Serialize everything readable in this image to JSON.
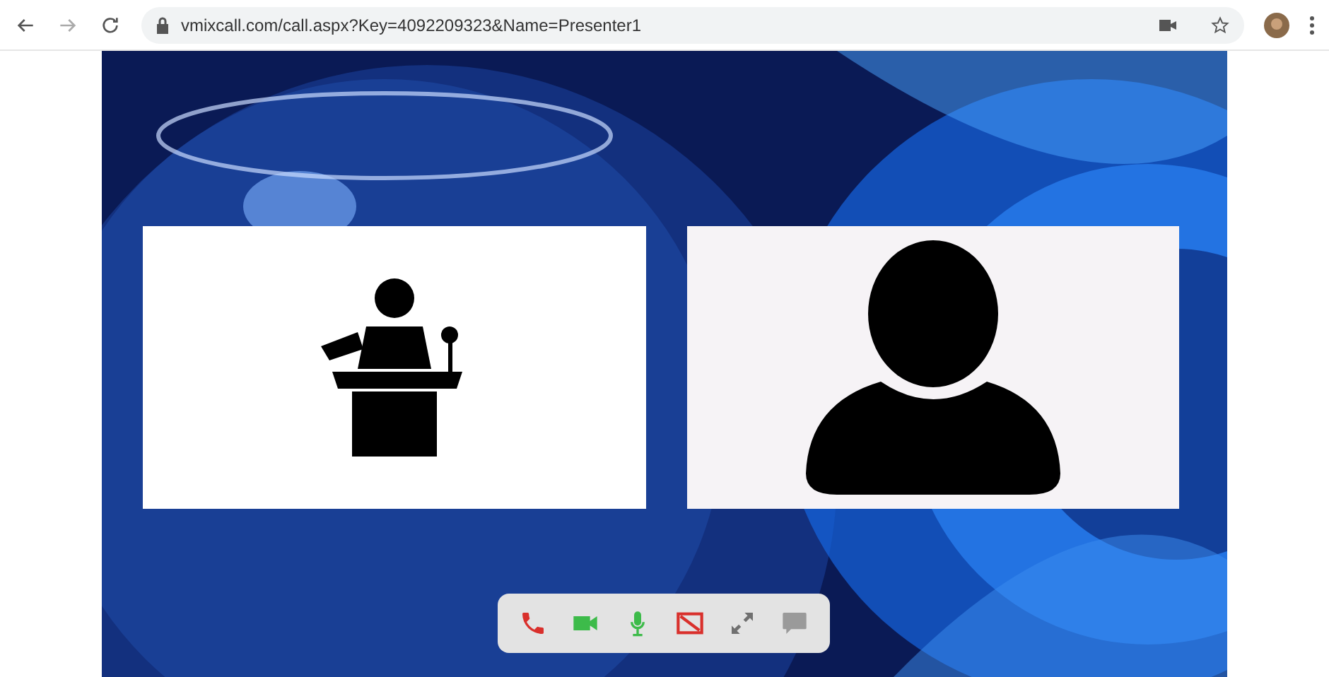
{
  "browser": {
    "url": "vmixcall.com/call.aspx?Key=4092209323&Name=Presenter1"
  },
  "tiles": [
    {
      "kind": "presenter"
    },
    {
      "kind": "person"
    }
  ],
  "controls": [
    {
      "kind": "hangup",
      "color": "#d9302c"
    },
    {
      "kind": "camera",
      "color": "#3dbb4a"
    },
    {
      "kind": "microphone",
      "color": "#3dbb4a"
    },
    {
      "kind": "screen",
      "color": "#d9302c"
    },
    {
      "kind": "fullscreen",
      "color": "#707070"
    },
    {
      "kind": "chat",
      "color": "#9a9a9a"
    }
  ]
}
